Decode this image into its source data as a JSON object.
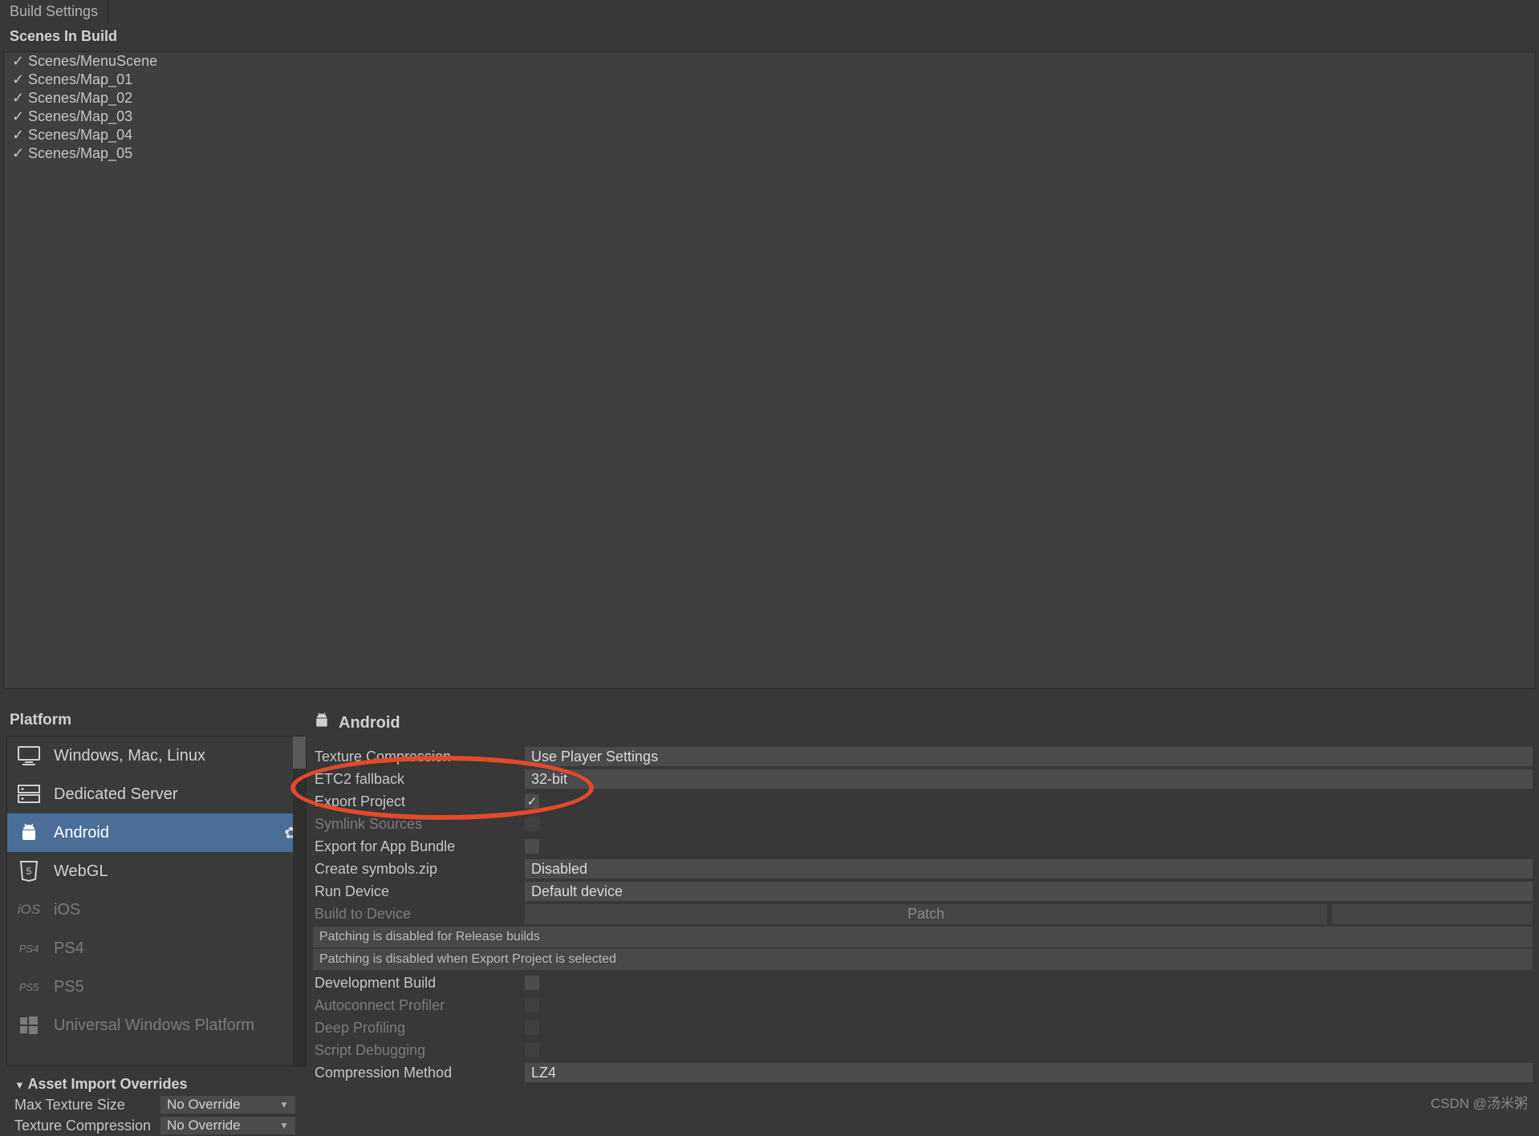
{
  "tab_title": "Build Settings",
  "scenes_header": "Scenes In Build",
  "scenes": [
    "Scenes/MenuScene",
    "Scenes/Map_01",
    "Scenes/Map_02",
    "Scenes/Map_03",
    "Scenes/Map_04",
    "Scenes/Map_05"
  ],
  "platform_header": "Platform",
  "platforms": [
    {
      "label": "Windows, Mac, Linux",
      "dim": false
    },
    {
      "label": "Dedicated Server",
      "dim": false
    },
    {
      "label": "Android",
      "dim": false,
      "selected": true
    },
    {
      "label": "WebGL",
      "dim": false
    },
    {
      "label": "iOS",
      "dim": true
    },
    {
      "label": "PS4",
      "dim": true
    },
    {
      "label": "PS5",
      "dim": true
    },
    {
      "label": "Universal Windows Platform",
      "dim": true
    }
  ],
  "android_title": "Android",
  "settings": {
    "texture_compression": {
      "label": "Texture Compression",
      "value": "Use Player Settings"
    },
    "etc2": {
      "label": "ETC2 fallback",
      "value": "32-bit"
    },
    "export_project": {
      "label": "Export Project",
      "checked": true
    },
    "symlink": {
      "label": "Symlink Sources",
      "checked": false,
      "dim": true
    },
    "export_bundle": {
      "label": "Export for App Bundle",
      "checked": false
    },
    "create_symbols": {
      "label": "Create symbols.zip",
      "value": "Disabled"
    },
    "run_device": {
      "label": "Run Device",
      "value": "Default device"
    },
    "build_to_device": {
      "label": "Build to Device",
      "patch": "Patch",
      "dim": true
    },
    "info1": "Patching is disabled for Release builds",
    "info2": "Patching is disabled when Export Project is selected",
    "dev_build": {
      "label": "Development Build",
      "checked": false
    },
    "autoconnect": {
      "label": "Autoconnect Profiler",
      "checked": false,
      "dim": true
    },
    "deep": {
      "label": "Deep Profiling",
      "checked": false,
      "dim": true
    },
    "script_debug": {
      "label": "Script Debugging",
      "checked": false,
      "dim": true
    },
    "compression_method": {
      "label": "Compression Method",
      "value": "LZ4"
    }
  },
  "overrides": {
    "header": "Asset Import Overrides",
    "max_texture": {
      "label": "Max Texture Size",
      "value": "No Override"
    },
    "texture_compression": {
      "label": "Texture Compression",
      "value": "No Override"
    }
  },
  "watermark": "CSDN @汤米粥"
}
